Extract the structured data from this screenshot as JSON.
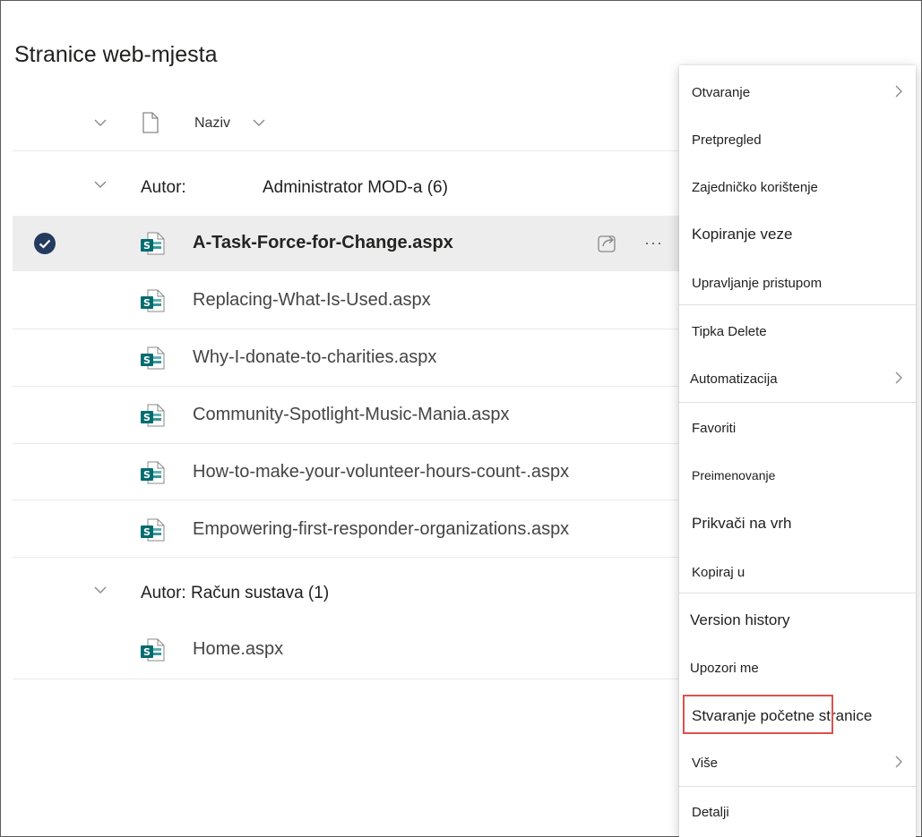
{
  "page": {
    "title": "Stranice web-mjesta"
  },
  "column_header": {
    "name_label": "Naziv"
  },
  "groups": [
    {
      "label": "Autor:",
      "value": "Administrator MOD-a (6)"
    },
    {
      "label": "Autor: Račun sustava (1)"
    }
  ],
  "files": [
    {
      "name": "A-Task-Force-for-Change.aspx",
      "selected": true
    },
    {
      "name": "Replacing-What-Is-Used.aspx"
    },
    {
      "name": "Why-I-donate-to-charities.aspx"
    },
    {
      "name": "Community-Spotlight-Music-Mania.aspx"
    },
    {
      "name": "How-to-make-your-volunteer-hours-count-.aspx"
    },
    {
      "name": "Empowering-first-responder-organizations.aspx"
    },
    {
      "name": "Home.aspx"
    }
  ],
  "row_actions": {
    "more": "···"
  },
  "context_menu": {
    "items": [
      {
        "label": "Otvaranje",
        "submenu": true
      },
      {
        "label": "Pretpregled"
      },
      {
        "label": "Zajedničko korištenje"
      },
      {
        "label": "Kopiranje veze"
      },
      {
        "label": "Upravljanje pristupom"
      },
      {
        "label": "Tipka Delete"
      },
      {
        "label": "Automatizacija",
        "submenu": true
      },
      {
        "label": "Favoriti"
      },
      {
        "label": "Preimenovanje"
      },
      {
        "label": "Prikvači na vrh"
      },
      {
        "label": "Kopiraj u"
      },
      {
        "label": "Version history"
      },
      {
        "label": "Upozori me"
      },
      {
        "label": "Stvaranje početne stranice",
        "highlighted": true
      },
      {
        "label": "Više",
        "submenu": true
      },
      {
        "label": "Detalji"
      }
    ]
  },
  "colors": {
    "accent": "#036c70",
    "selected_row": "#ededed",
    "highlight": "#d9534f",
    "check": "#243a5e"
  }
}
